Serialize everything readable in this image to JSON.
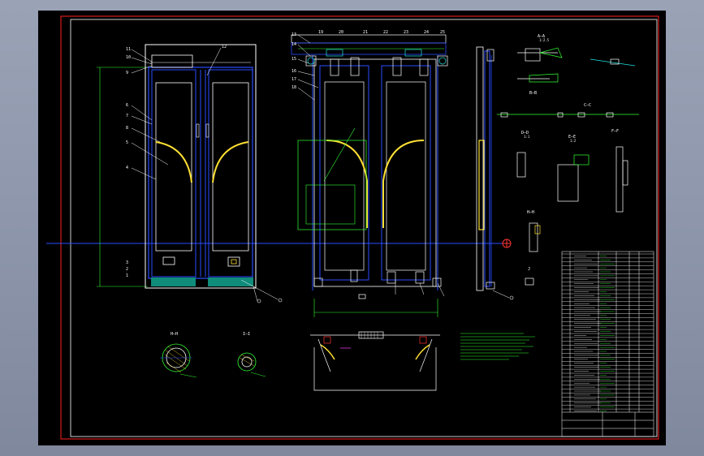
{
  "drawing": {
    "background": "#000000",
    "frame_color": "#ff2020",
    "line_colors": {
      "outline": "#ffffff",
      "blue": "#2a4cff",
      "green": "#33ff33",
      "yellow": "#ffe033",
      "cyan": "#20e0e0",
      "magenta": "#ff40ff",
      "teal_fill": "#0f8c7a",
      "red": "#ff3333"
    },
    "section_labels": {
      "a_a": "A—A",
      "b_b": "B—B",
      "c_c": "C—C",
      "d_d": "D—D",
      "e_e": "E—E",
      "f_f": "F—F",
      "h_h": "H—H",
      "i_i": "I—I",
      "j": "J"
    },
    "scale_labels": {
      "s1": "1:2.5",
      "s2": "1:1",
      "s3": "1:2"
    },
    "balloons_front": [
      "11",
      "10",
      "9",
      "6",
      "7",
      "8",
      "5",
      "4",
      "3",
      "2",
      "1",
      "12"
    ],
    "balloons_mech": [
      "13",
      "14",
      "15",
      "16",
      "17",
      "18",
      "19",
      "20",
      "21",
      "22",
      "23",
      "24",
      "25"
    ]
  }
}
